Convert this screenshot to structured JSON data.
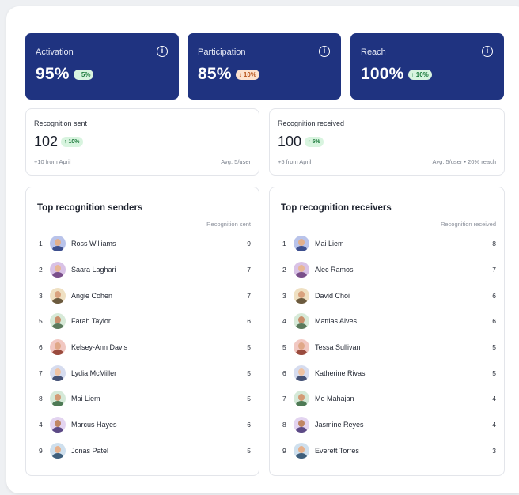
{
  "kpis": [
    {
      "label": "Activation",
      "value": "95%",
      "badge": "↑ 5%",
      "trend": "up",
      "info_icon": "i"
    },
    {
      "label": "Participation",
      "value": "85%",
      "badge": "↓ 10%",
      "trend": "down",
      "info_icon": "i"
    },
    {
      "label": "Reach",
      "value": "100%",
      "badge": "↑ 10%",
      "trend": "up",
      "info_icon": "i"
    }
  ],
  "stats": [
    {
      "label": "Recognition sent",
      "value": "102",
      "badge": "↑ 10%",
      "foot_left": "+10 from April",
      "foot_right": "Avg. 5/user"
    },
    {
      "label": "Recognition received",
      "value": "100",
      "badge": "↑ 5%",
      "foot_left": "+5 from April",
      "foot_right": "Avg. 5/user • 20% reach"
    }
  ],
  "senders": {
    "title": "Top recognition senders",
    "column": "Recognition sent",
    "rows": [
      {
        "rank": "1",
        "name": "Ross Williams",
        "count": "9"
      },
      {
        "rank": "2",
        "name": "Saara Laghari",
        "count": "7"
      },
      {
        "rank": "3",
        "name": "Angie Cohen",
        "count": "7"
      },
      {
        "rank": "5",
        "name": "Farah Taylor",
        "count": "6"
      },
      {
        "rank": "6",
        "name": "Kelsey-Ann Davis",
        "count": "5"
      },
      {
        "rank": "7",
        "name": "Lydia McMiller",
        "count": "5"
      },
      {
        "rank": "8",
        "name": "Mai Liem",
        "count": "5"
      },
      {
        "rank": "4",
        "name": "Marcus Hayes",
        "count": "6"
      },
      {
        "rank": "9",
        "name": "Jonas Patel",
        "count": "5"
      }
    ]
  },
  "receivers": {
    "title": "Top recognition receivers",
    "column": "Recognition received",
    "rows": [
      {
        "rank": "1",
        "name": "Mai Liem",
        "count": "8"
      },
      {
        "rank": "2",
        "name": "Alec Ramos",
        "count": "7"
      },
      {
        "rank": "3",
        "name": "David Choi",
        "count": "6"
      },
      {
        "rank": "4",
        "name": "Mattias Alves",
        "count": "6"
      },
      {
        "rank": "5",
        "name": "Tessa Sullivan",
        "count": "5"
      },
      {
        "rank": "6",
        "name": "Katherine Rivas",
        "count": "5"
      },
      {
        "rank": "7",
        "name": "Mo Mahajan",
        "count": "4"
      },
      {
        "rank": "8",
        "name": "Jasmine Reyes",
        "count": "4"
      },
      {
        "rank": "9",
        "name": "Everett Torres",
        "count": "3"
      }
    ]
  },
  "colors": {
    "kpi_background": "#1f3380",
    "badge_up_bg": "#d8f4df",
    "badge_down_bg": "#fde2cf"
  }
}
